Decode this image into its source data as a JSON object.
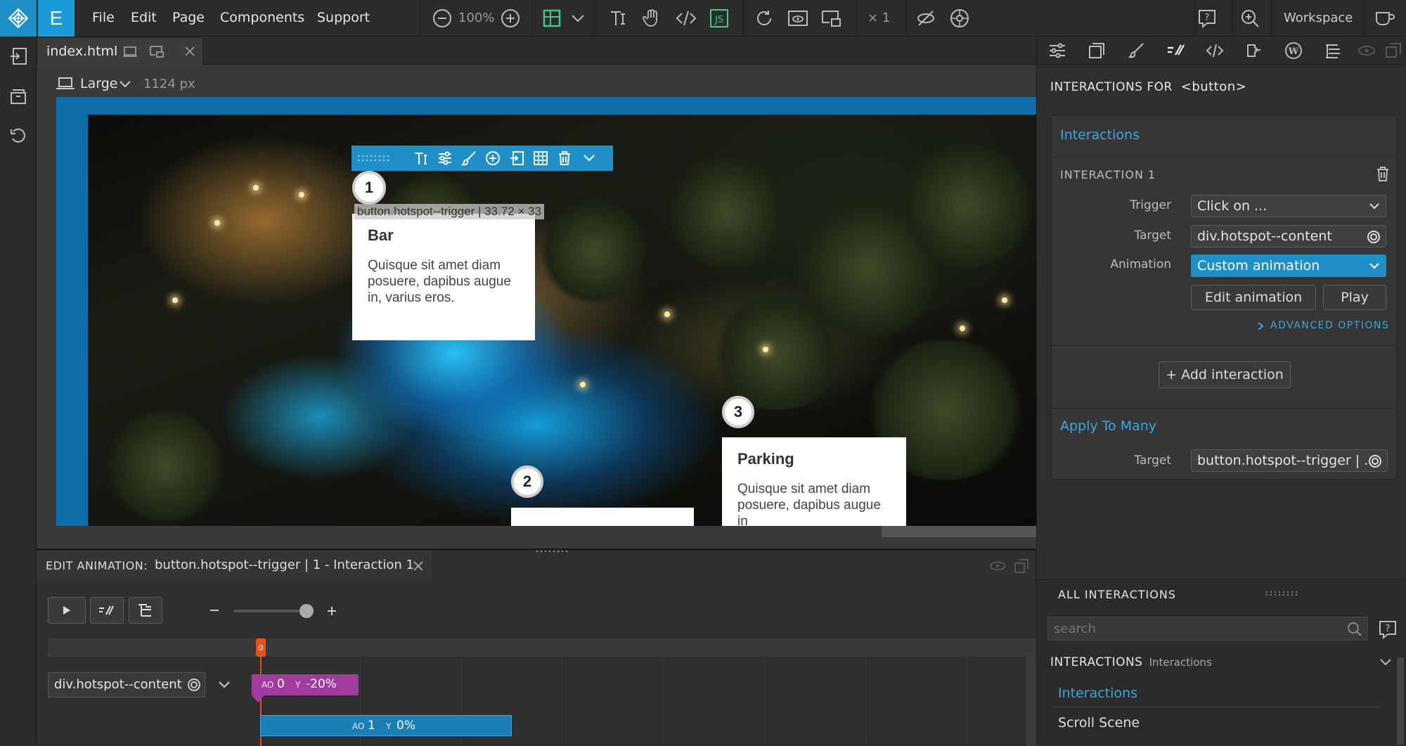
{
  "menu": {
    "file": "File",
    "edit": "Edit",
    "page": "Page",
    "components": "Components",
    "support": "Support"
  },
  "toolbar": {
    "zoom": "100%",
    "multiplier": "× 1",
    "workspace": "Workspace"
  },
  "tabs": {
    "file": "index.html"
  },
  "canvas": {
    "device": "Large",
    "width": "1124 px"
  },
  "selection": {
    "label": "button.hotspot--trigger | 33.72 × 33"
  },
  "hotspots": [
    {
      "number": "1",
      "title": "Bar",
      "text": "Quisque sit amet diam posuere, dapibus augue in, varius eros."
    },
    {
      "number": "2"
    },
    {
      "number": "3",
      "title": "Parking",
      "text": "Quisque sit amet diam posuere, dapibus augue in"
    }
  ],
  "right_panel": {
    "header_prefix": "INTERACTIONS FOR",
    "header_tag": "<button>",
    "section_title": "Interactions",
    "interaction_title": "INTERACTION 1",
    "trigger_label": "Trigger",
    "trigger_value": "Click on ...",
    "target_label": "Target",
    "target_value": "div.hotspot--content",
    "animation_label": "Animation",
    "animation_value": "Custom animation",
    "edit_animation": "Edit animation",
    "play": "Play",
    "advanced": "ADVANCED OPTIONS",
    "add_interaction": "+ Add interaction",
    "apply_title": "Apply To Many",
    "apply_target_label": "Target",
    "apply_target_value": "button.hotspot--trigger | ...",
    "all_title": "ALL INTERACTIONS",
    "search_placeholder": "search",
    "group_title": "INTERACTIONS",
    "group_sub": "Interactions",
    "list": [
      "Interactions",
      "Scroll Scene"
    ]
  },
  "anim_panel": {
    "title_prefix": "EDIT ANIMATION:",
    "title_value": "button.hotspot--trigger | 1 - Interaction 1",
    "marker": "0",
    "target": "div.hotspot--content",
    "key1_ao_label": "AO",
    "key1_ao": "0",
    "key1_y_label": "Y",
    "key1_y": "-20%",
    "key2_ao_label": "AO",
    "key2_ao": "1",
    "key2_y_label": "Y",
    "key2_y": "0%"
  },
  "colors": {
    "accent": "#1f8fc7",
    "panel": "#2f2f2f",
    "link": "#3aa7e0",
    "keyframe_purple": "#a33aa0",
    "keyframe_blue": "#1a7fb5",
    "marker": "#e8501f"
  }
}
